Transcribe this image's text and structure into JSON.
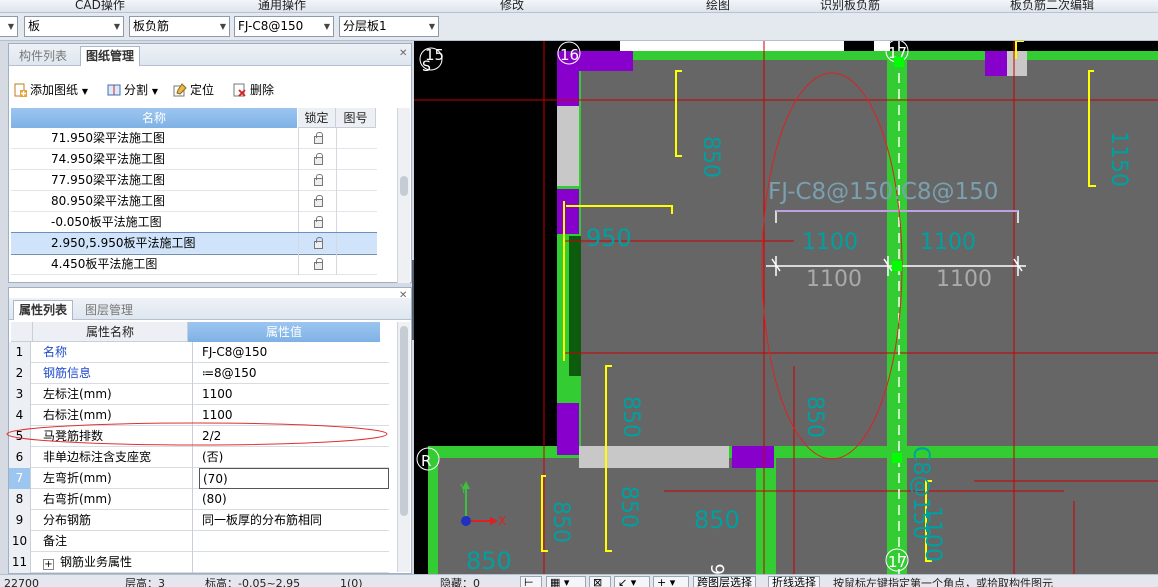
{
  "menu_strip": [
    "CAD操作",
    "通用操作",
    "修改",
    "绘图",
    "识别板负筋",
    "板负筋二次编辑"
  ],
  "selectors": {
    "floor": "",
    "category": "板",
    "type": "板负筋",
    "component": "FJ-C8@150",
    "layer_group": "分层板1"
  },
  "drawing_panel": {
    "tabs": [
      "构件列表",
      "图纸管理"
    ],
    "active_tab": "图纸管理",
    "toolbar": {
      "add": "添加图纸",
      "split": "分割",
      "locate": "定位",
      "delete": "删除"
    },
    "columns": [
      "名称",
      "锁定",
      "图号"
    ],
    "rows": [
      "71.950梁平法施工图",
      "74.950梁平法施工图",
      "77.950梁平法施工图",
      "80.950梁平法施工图",
      "-0.050板平法施工图",
      "2.950,5.950板平法施工图",
      "4.450板平法施工图"
    ],
    "selected_row_index": 5
  },
  "property_panel": {
    "tabs": [
      "属性列表",
      "图层管理"
    ],
    "active_tab": "属性列表",
    "columns": [
      "属性名称",
      "属性值"
    ],
    "rows": [
      {
        "num": "1",
        "name": "名称",
        "value": "FJ-C8@150",
        "blue": true
      },
      {
        "num": "2",
        "name": "钢筋信息",
        "value": "≔8@150",
        "blue": true
      },
      {
        "num": "3",
        "name": "左标注(mm)",
        "value": "1100",
        "blue": false
      },
      {
        "num": "4",
        "name": "右标注(mm)",
        "value": "1100",
        "blue": false
      },
      {
        "num": "5",
        "name": "马凳筋排数",
        "value": "2/2",
        "blue": false
      },
      {
        "num": "6",
        "name": "非单边标注含支座宽",
        "value": "(否)",
        "blue": false
      },
      {
        "num": "7",
        "name": "左弯折(mm)",
        "value": "(70)",
        "blue": false
      },
      {
        "num": "8",
        "name": "右弯折(mm)",
        "value": "(80)",
        "blue": false
      },
      {
        "num": "9",
        "name": "分布钢筋",
        "value": "同一板厚的分布筋相同",
        "blue": false
      },
      {
        "num": "10",
        "name": "备注",
        "value": "",
        "blue": false
      },
      {
        "num": "11",
        "name": "钢筋业务属性",
        "value": "",
        "blue": false,
        "expander": "+"
      }
    ]
  },
  "canvas": {
    "axis_labels": {
      "a15": "15",
      "a16": "16",
      "a17": "17",
      "a17b": "17",
      "s": "S",
      "r": "R",
      "six": "6"
    },
    "rebar_label": "FJ-C8@150:C8@150",
    "dims": {
      "left_inner": "1100",
      "right_inner": "1100",
      "left_outer": "1100",
      "right_outer": "1100"
    },
    "cyan_dims": [
      "850",
      "950",
      "1150",
      "850",
      "850",
      "850",
      "850",
      "850",
      "850",
      "1100",
      "C8@150"
    ],
    "axis_y": "Y",
    "axis_x": "X"
  },
  "statusbar": {
    "coord": "22700",
    "floor_height": "层高：3",
    "elevation": "标高：-0.05~2.95",
    "count": "1(0)",
    "hidden": "隐藏：0",
    "buttons": [
      "跨图层选择",
      "折线选择"
    ],
    "hint": "按鼠标左键指定第一个角点，或拾取构件图元"
  },
  "colors": {
    "green_beam": "#33cc33",
    "purple": "#8800cc",
    "slab": "#666666",
    "cyan_text": "#00a0a0",
    "yellow_rebar": "#ffff00",
    "red_line": "#cc0000"
  }
}
